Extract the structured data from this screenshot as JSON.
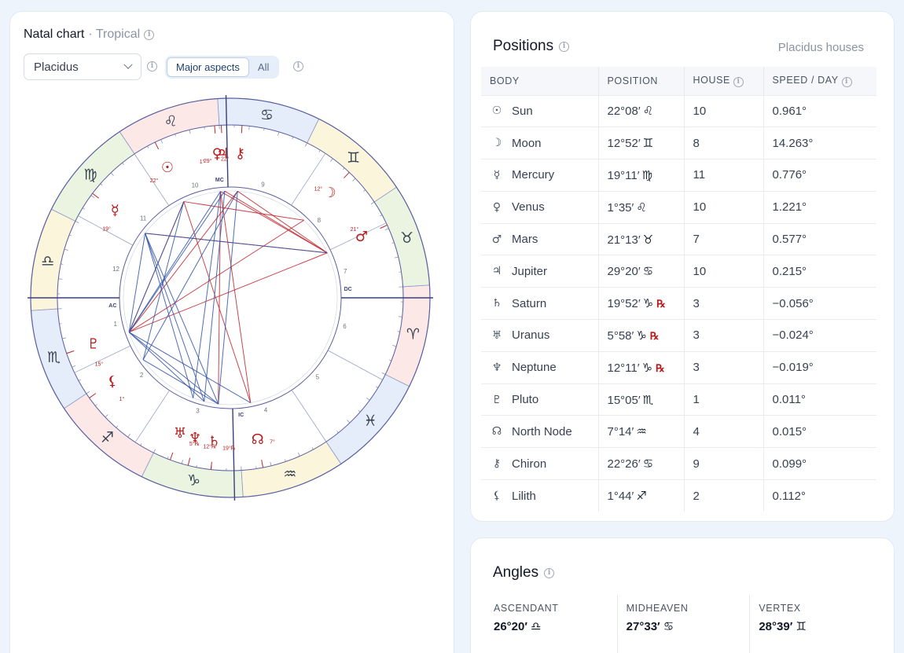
{
  "natal": {
    "title": "Natal chart",
    "subtitle": "· Tropical",
    "house_system": "Placidus",
    "seg_major": "Major aspects",
    "seg_all": "All"
  },
  "positions": {
    "title": "Positions",
    "subtitle": "Placidus houses",
    "headers": {
      "body": "BODY",
      "position": "POSITION",
      "house": "HOUSE",
      "speed": "SPEED / DAY"
    },
    "rows": [
      {
        "glyph": "☉",
        "name": "Sun",
        "pos": "22°08′",
        "sign": "♌",
        "retro": "",
        "house": "10",
        "speed": "0.961°"
      },
      {
        "glyph": "☽",
        "name": "Moon",
        "pos": "12°52′",
        "sign": "♊",
        "retro": "",
        "house": "8",
        "speed": "14.263°"
      },
      {
        "glyph": "☿",
        "name": "Mercury",
        "pos": "19°11′",
        "sign": "♍",
        "retro": "",
        "house": "11",
        "speed": "0.776°"
      },
      {
        "glyph": "♀",
        "name": "Venus",
        "pos": "1°35′",
        "sign": "♌",
        "retro": "",
        "house": "10",
        "speed": "1.221°"
      },
      {
        "glyph": "♂",
        "name": "Mars",
        "pos": "21°13′",
        "sign": "♉",
        "retro": "",
        "house": "7",
        "speed": "0.577°"
      },
      {
        "glyph": "♃",
        "name": "Jupiter",
        "pos": "29°20′",
        "sign": "♋",
        "retro": "",
        "house": "10",
        "speed": "0.215°"
      },
      {
        "glyph": "♄",
        "name": "Saturn",
        "pos": "19°52′",
        "sign": "♑",
        "retro": "℞",
        "house": "3",
        "speed": "−0.056°"
      },
      {
        "glyph": "♅",
        "name": "Uranus",
        "pos": "5°58′",
        "sign": "♑",
        "retro": "℞",
        "house": "3",
        "speed": "−0.024°"
      },
      {
        "glyph": "♆",
        "name": "Neptune",
        "pos": "12°11′",
        "sign": "♑",
        "retro": "℞",
        "house": "3",
        "speed": "−0.019°"
      },
      {
        "glyph": "♇",
        "name": "Pluto",
        "pos": "15°05′",
        "sign": "♏",
        "retro": "",
        "house": "1",
        "speed": "0.011°"
      },
      {
        "glyph": "☊",
        "name": "North Node",
        "pos": "7°14′",
        "sign": "♒",
        "retro": "",
        "house": "4",
        "speed": "0.015°"
      },
      {
        "glyph": "⚷",
        "name": "Chiron",
        "pos": "22°26′",
        "sign": "♋",
        "retro": "",
        "house": "9",
        "speed": "0.099°"
      },
      {
        "glyph": "⚸",
        "name": "Lilith",
        "pos": "1°44′",
        "sign": "♐",
        "retro": "",
        "house": "2",
        "speed": "0.112°"
      }
    ]
  },
  "angles": {
    "title": "Angles",
    "items": [
      {
        "label": "ASCENDANT",
        "value": "26°20′ ♎"
      },
      {
        "label": "MIDHEAVEN",
        "value": "27°33′ ♋"
      },
      {
        "label": "VERTEX",
        "value": "28°39′ ♊"
      }
    ]
  },
  "wheel": {
    "ascendant_deg": 206.33,
    "cusps": [
      206.33,
      232.0,
      263.0,
      297.55,
      330.0,
      358.0,
      26.33,
      52.0,
      83.0,
      117.55,
      150.0,
      178.0
    ],
    "house_numbers": [
      "1",
      "2",
      "3",
      "4",
      "5",
      "6",
      "7",
      "8",
      "9",
      "10",
      "11",
      "12"
    ],
    "angle_labels": {
      "asc": "AC",
      "dc": "DC",
      "mc": "MC",
      "ic": "IC"
    },
    "signs": [
      "♈",
      "♉",
      "♊",
      "♋",
      "♌",
      "♍",
      "♎",
      "♏",
      "♐",
      "♑",
      "♒",
      "♓"
    ],
    "sign_colors": [
      "#fde8e8",
      "#eaf4e0",
      "#fbf5dc",
      "#e5edfa",
      "#fde8e8",
      "#eaf4e0",
      "#fbf5dc",
      "#e5edfa",
      "#fde8e8",
      "#eaf4e0",
      "#fbf5dc",
      "#e5edfa"
    ],
    "planets": [
      {
        "glyph": "☉",
        "lon": 142.13,
        "deg": "22°"
      },
      {
        "glyph": "☽",
        "lon": 72.87,
        "deg": "12°"
      },
      {
        "glyph": "☿",
        "lon": 169.18,
        "deg": "19°"
      },
      {
        "glyph": "♀",
        "lon": 121.58,
        "deg": "1°"
      },
      {
        "glyph": "♂",
        "lon": 51.22,
        "deg": "21°"
      },
      {
        "glyph": "♃",
        "lon": 119.33,
        "deg": "29°"
      },
      {
        "glyph": "♄",
        "lon": 289.87,
        "deg": "19°℞"
      },
      {
        "glyph": "♅",
        "lon": 275.97,
        "deg": "5°℞"
      },
      {
        "glyph": "♆",
        "lon": 282.18,
        "deg": "12°℞"
      },
      {
        "glyph": "♇",
        "lon": 225.08,
        "deg": "15°"
      },
      {
        "glyph": "☊",
        "lon": 307.23,
        "deg": "7°"
      },
      {
        "glyph": "⚷",
        "lon": 112.43,
        "deg": "22°"
      },
      {
        "glyph": "⚸",
        "lon": 241.73,
        "deg": "1°"
      }
    ],
    "aspects": [
      {
        "a": 3,
        "b": 4,
        "type": "red"
      },
      {
        "a": 5,
        "b": 4,
        "type": "red"
      },
      {
        "a": 11,
        "b": 4,
        "type": "red"
      },
      {
        "a": 0,
        "b": 1,
        "type": "red"
      },
      {
        "a": 9,
        "b": 4,
        "type": "red"
      },
      {
        "a": 9,
        "b": 0,
        "type": "red"
      },
      {
        "a": 9,
        "b": 1,
        "type": "red"
      },
      {
        "a": 0,
        "b": 10,
        "type": "red"
      },
      {
        "a": 3,
        "b": 10,
        "type": "red"
      },
      {
        "a": 2,
        "b": 4,
        "type": "red"
      },
      {
        "a": 6,
        "b": 3,
        "type": "red"
      },
      {
        "a": 9,
        "b": 11,
        "type": "red"
      },
      {
        "a": 2,
        "b": 9,
        "type": "blue"
      },
      {
        "a": 2,
        "b": 6,
        "type": "blue"
      },
      {
        "a": 2,
        "b": 7,
        "type": "blue"
      },
      {
        "a": 2,
        "b": 8,
        "type": "blue"
      },
      {
        "a": 2,
        "b": 4,
        "type": "blue"
      },
      {
        "a": 0,
        "b": 9,
        "type": "blue"
      },
      {
        "a": 3,
        "b": 9,
        "type": "blue"
      },
      {
        "a": 5,
        "b": 9,
        "type": "blue"
      },
      {
        "a": 11,
        "b": 12,
        "type": "blue"
      },
      {
        "a": 0,
        "b": 12,
        "type": "blue"
      },
      {
        "a": 5,
        "b": 8,
        "type": "blue"
      },
      {
        "a": 3,
        "b": 7,
        "type": "blue"
      },
      {
        "a": 9,
        "b": 8,
        "type": "blue"
      },
      {
        "a": 9,
        "b": 6,
        "type": "blue"
      },
      {
        "a": 12,
        "b": 6,
        "type": "blue"
      },
      {
        "a": 10,
        "b": 9,
        "type": "blue"
      },
      {
        "a": 11,
        "b": 6,
        "type": "blue"
      }
    ]
  }
}
